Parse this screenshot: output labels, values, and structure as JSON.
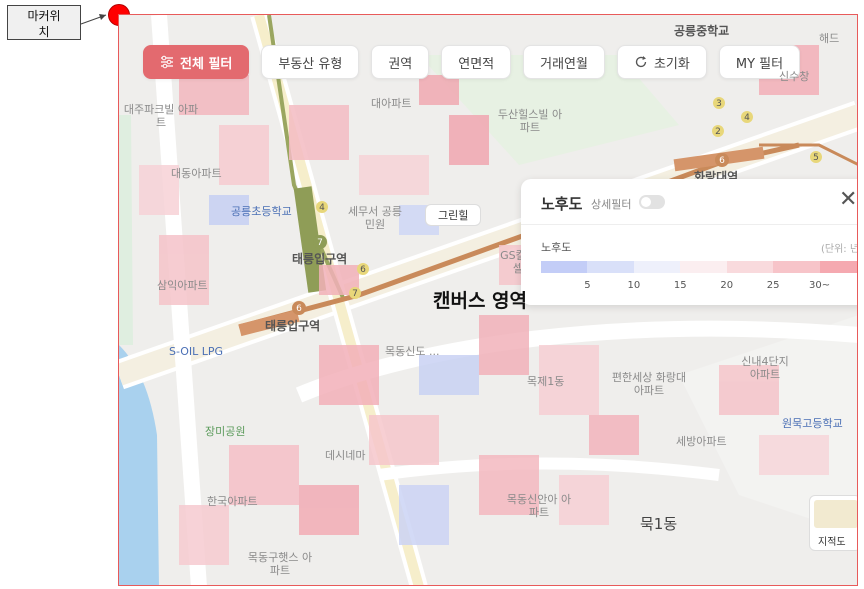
{
  "marker": {
    "label": "마커위\n치"
  },
  "filters": [
    {
      "label": "전체 필터",
      "icon": "sliders-icon",
      "active": true
    },
    {
      "label": "부동산 유형"
    },
    {
      "label": "권역"
    },
    {
      "label": "연면적"
    },
    {
      "label": "거래연월"
    },
    {
      "label": "초기화",
      "icon": "refresh-icon"
    },
    {
      "label": "MY 필터"
    }
  ],
  "map": {
    "canvas_label": "캔버스 영역",
    "area_name": "묵1동",
    "greenhill_label": "그린힐",
    "station_label": "태릉입구역",
    "jijeok_label": "지적도",
    "pois": [
      "공릉중학교",
      "대주파크빌 아파트",
      "대동아파트",
      "공릉초등학교",
      "세무서 공릉민원",
      "삼익아파트",
      "S-OIL LPG",
      "대아파트",
      "두산힐스빌 아파트",
      "태릉입구역",
      "GS칼텍스 셀프",
      "목동신도 ...",
      "목제1동",
      "편한세상 화랑대아파트",
      "신내4단지 아파트",
      "원묵고등학교",
      "장미공원",
      "세방아파트",
      "데시네마",
      "한국아파트",
      "목동신안아 아파트",
      "목동구햇스 아파트",
      "신수창",
      "해드",
      "화랑대역"
    ]
  },
  "panel": {
    "title": "노후도",
    "subfilter": "상세필터",
    "legend_label": "노후도",
    "unit": "(단위: 년)",
    "ticks": [
      "5",
      "10",
      "15",
      "20",
      "25",
      "30~"
    ],
    "colors": [
      "#c3cdf7",
      "#d9e0f9",
      "#eef0fb",
      "#fbeef0",
      "#f9dadd",
      "#f7c4c9",
      "#f5a9b0"
    ]
  }
}
